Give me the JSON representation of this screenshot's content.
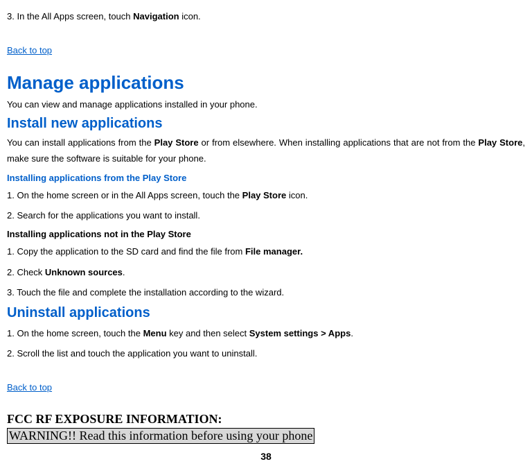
{
  "intro_step": {
    "prefix": "3. In the All Apps screen, touch ",
    "bold": "Navigation",
    "suffix": " icon."
  },
  "back_to_top_1": "Back to top",
  "h1_manage": "Manage applications",
  "manage_intro": "You can view and manage applications installed in your phone.",
  "h2_install": "Install new applications",
  "install_para": {
    "p1": "You can install applications from the ",
    "b1": "Play Store",
    "p2": " or from elsewhere. When installing applications that are not from the ",
    "b2": "Play Store",
    "p3": ", make sure the software is suitable for your phone."
  },
  "sub_from_store": "Installing applications from the Play Store",
  "store_steps": {
    "s1": {
      "pre": "1. On the home screen or in the All Apps screen, touch the ",
      "b": "Play Store",
      "post": " icon."
    },
    "s2": "2. Search for the applications you want to install."
  },
  "sub_not_store": "Installing applications not in the Play Store",
  "notstore_steps": {
    "s1": {
      "pre": "1. Copy the application to the SD card and find the file from ",
      "b": "File manager."
    },
    "s2": {
      "pre": "2. Check ",
      "b": "Unknown sources",
      "post": "."
    },
    "s3": "3. Touch the file and complete the installation according to the wizard."
  },
  "h2_uninstall": "Uninstall applications",
  "uninstall_steps": {
    "s1": {
      "pre": "1. On the home screen, touch the ",
      "b1": "Menu",
      "mid": " key and then select ",
      "b2": "System settings > Apps",
      "post": "."
    },
    "s2": "2. Scroll the list and touch the application you want to uninstall."
  },
  "back_to_top_2": "Back to top",
  "fcc_heading": "FCC RF EXPOSURE INFORMATION:",
  "warning": "WARNING!! Read this information before using your phone",
  "page_number": "38"
}
